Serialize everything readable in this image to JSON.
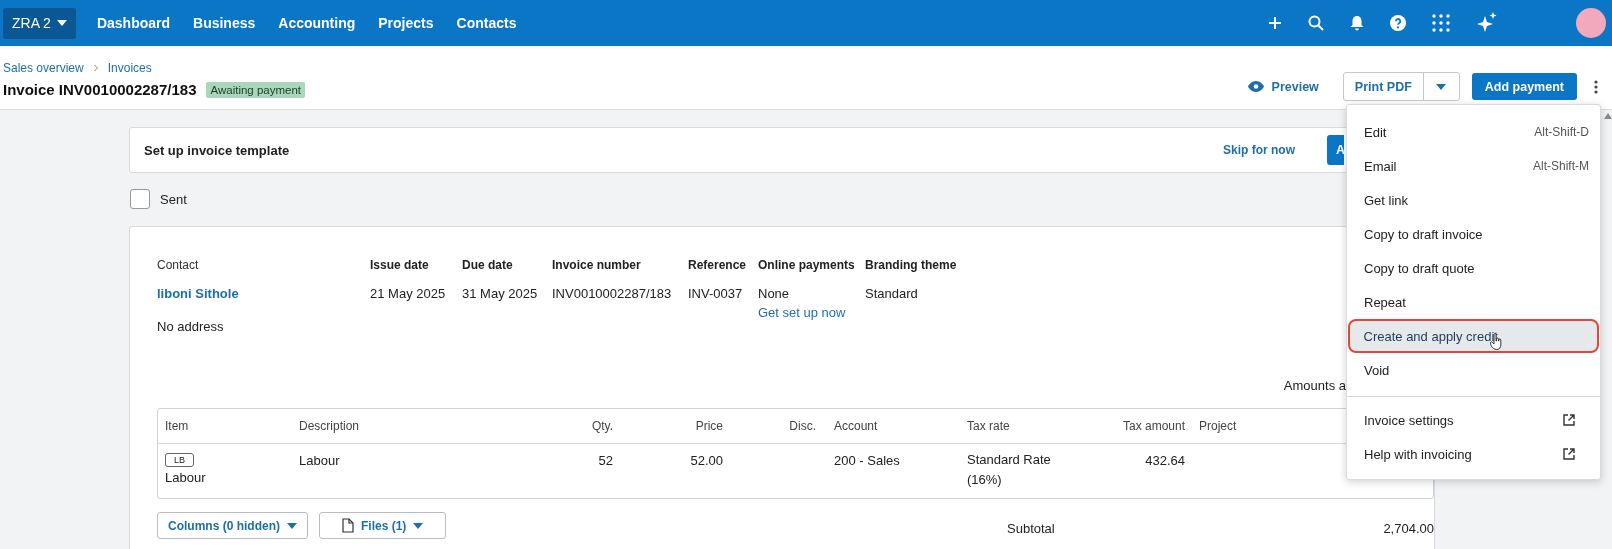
{
  "top_nav": {
    "org_switcher": "ZRA 2",
    "items": [
      {
        "label": "Dashboard"
      },
      {
        "label": "Business"
      },
      {
        "label": "Accounting"
      },
      {
        "label": "Projects"
      },
      {
        "label": "Contacts"
      }
    ]
  },
  "header": {
    "breadcrumbs": [
      "Sales overview",
      "Invoices"
    ],
    "title": "Invoice INV0010002287/183",
    "status": "Awaiting payment",
    "preview": "Preview",
    "print": "Print PDF",
    "primary": "Add payment"
  },
  "template_banner": {
    "title": "Set up invoice template",
    "skip": "Skip for now",
    "button": "A"
  },
  "sent": {
    "label": "Sent",
    "checked": false
  },
  "invoice": {
    "fields": [
      {
        "label": "Contact",
        "value": "liboni Sithole",
        "kind": "link",
        "note": "No address"
      },
      {
        "label": "Issue date",
        "value": "21 May 2025",
        "kind": "text"
      },
      {
        "label": "Due date",
        "value": "31 May 2025",
        "kind": "text"
      },
      {
        "label": "Invoice number",
        "value": "INV0010002287/183",
        "kind": "text"
      },
      {
        "label": "Reference",
        "value": "INV-0037",
        "kind": "text"
      },
      {
        "label": "Online payments",
        "value": "None",
        "kind": "text",
        "link": "Get set up now"
      },
      {
        "label": "Branding theme",
        "value": "Standard",
        "kind": "text"
      }
    ],
    "amounts_note": "Amounts a",
    "columns": [
      "Item",
      "Description",
      "Qty.",
      "Price",
      "Disc.",
      "Account",
      "Tax rate",
      "Tax amount",
      "Project"
    ],
    "rows": [
      {
        "item_code": "LB",
        "item": "Labour",
        "description": "Labour",
        "qty": "52",
        "price": "52.00",
        "account": "200 - Sales",
        "tax_rate": "Standard Rate (16%)",
        "tax_amount": "432.64"
      }
    ],
    "columns_button": "Columns (0 hidden)",
    "files_button": "Files (1)",
    "subtotal": {
      "label": "Subtotal",
      "value": "2,704.00"
    }
  },
  "menu": {
    "groups": [
      {
        "items": [
          {
            "label": "Edit",
            "shortcut": "Alt-Shift-D",
            "kind": "action",
            "selected": false
          },
          {
            "label": "Email",
            "shortcut": "Alt-Shift-M",
            "kind": "action",
            "selected": false
          },
          {
            "label": "Get link",
            "kind": "action",
            "selected": false
          },
          {
            "label": "Copy to draft invoice",
            "kind": "action",
            "selected": false
          },
          {
            "label": "Copy to draft quote",
            "kind": "action",
            "selected": false
          },
          {
            "label": "Repeat",
            "kind": "action",
            "selected": false
          },
          {
            "label": "Create and apply credit",
            "kind": "action",
            "selected": true
          },
          {
            "label": "Void",
            "kind": "action",
            "selected": false
          }
        ]
      },
      {
        "items": [
          {
            "label": "Invoice settings",
            "kind": "external",
            "selected": false
          },
          {
            "label": "Help with invoicing",
            "kind": "external",
            "selected": false
          }
        ]
      }
    ]
  }
}
